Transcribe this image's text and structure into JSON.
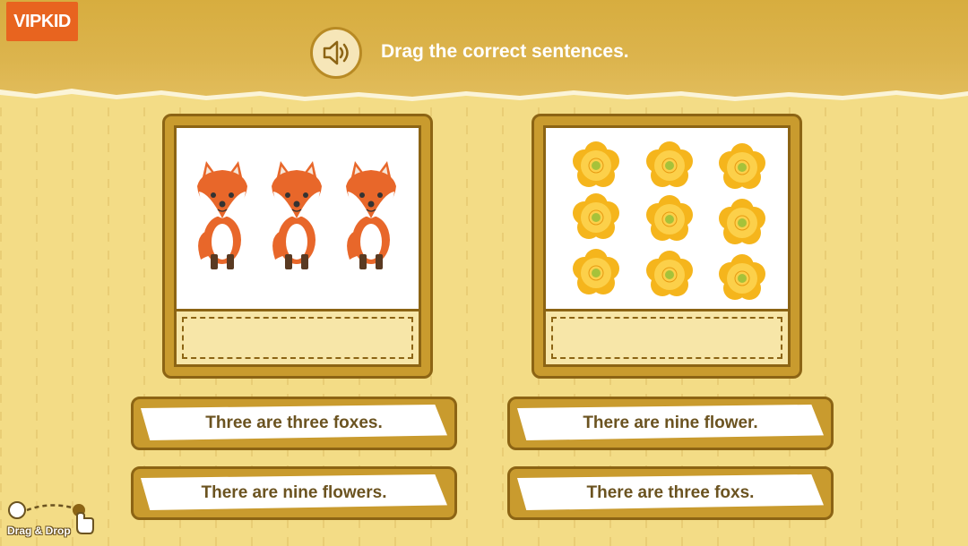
{
  "header": {
    "logo_text": "VIPKID",
    "instruction": "Drag the correct sentences."
  },
  "cards": [
    {
      "subject": "fox",
      "count": 3
    },
    {
      "subject": "flower",
      "count": 9
    }
  ],
  "sentences": [
    {
      "text": "Three are three foxes."
    },
    {
      "text": "There are nine flower."
    },
    {
      "text": "There are nine flowers."
    },
    {
      "text": "There are three foxs."
    }
  ],
  "hint": {
    "label": "Drag & Drop"
  },
  "colors": {
    "frame": "#c99b2e",
    "frame_border": "#8c6414",
    "header": "#d7ad3f",
    "logo": "#e8641f",
    "fox": "#e8672a",
    "flower": "#f5b51c"
  }
}
